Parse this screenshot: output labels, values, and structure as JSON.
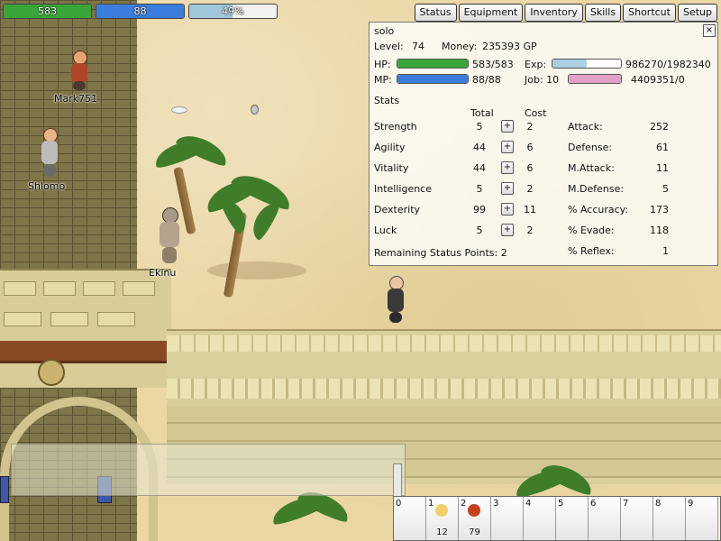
{
  "hud": {
    "hp": {
      "text": "583",
      "fraction": 1.0,
      "color": "#3aa63a"
    },
    "mp": {
      "text": "88",
      "fraction": 1.0,
      "color": "#3b7ddc"
    },
    "xp": {
      "text": "49%",
      "fraction": 0.49,
      "color": "#9fc7d9"
    }
  },
  "menu": [
    "Status",
    "Equipment",
    "Inventory",
    "Skills",
    "Shortcut",
    "Setup"
  ],
  "players": [
    {
      "name": "Mark751"
    },
    {
      "name": "Shlomo"
    },
    {
      "name": "Ekinu"
    }
  ],
  "status_window": {
    "title": "solo",
    "close": "×",
    "level_label": "Level:",
    "level": "74",
    "money_label": "Money:",
    "money": "235393 GP",
    "hp_label": "HP:",
    "hp_text": "583/583",
    "hp_fraction": 1.0,
    "mp_label": "MP:",
    "mp_text": "88/88",
    "mp_fraction": 1.0,
    "exp_label": "Exp:",
    "exp_text": "986270/1982340",
    "exp_fraction": 0.5,
    "job_label": "Job: 10",
    "job_text": "4409351/0",
    "job_fraction": 1.0,
    "stats_heading": "Stats",
    "total_header": "Total",
    "cost_header": "Cost",
    "stats": [
      {
        "name": "Strength",
        "total": "5",
        "cost": "2"
      },
      {
        "name": "Agility",
        "total": "44",
        "cost": "6"
      },
      {
        "name": "Vitality",
        "total": "44",
        "cost": "6"
      },
      {
        "name": "Intelligence",
        "total": "5",
        "cost": "2"
      },
      {
        "name": "Dexterity",
        "total": "99",
        "cost": "11"
      },
      {
        "name": "Luck",
        "total": "5",
        "cost": "2"
      }
    ],
    "plus_label": "+",
    "derived": [
      {
        "name": "Attack:",
        "value": "252"
      },
      {
        "name": "Defense:",
        "value": "61"
      },
      {
        "name": "M.Attack:",
        "value": "11"
      },
      {
        "name": "M.Defense:",
        "value": "5"
      },
      {
        "name": "% Accuracy:",
        "value": "173"
      },
      {
        "name": "% Evade:",
        "value": "118"
      },
      {
        "name": "% Reflex:",
        "value": "1"
      }
    ],
    "remaining_label": "Remaining Status Points: 2"
  },
  "shortcuts": [
    {
      "num": "0",
      "qty": ""
    },
    {
      "num": "1",
      "qty": "12"
    },
    {
      "num": "2",
      "qty": "79"
    },
    {
      "num": "3",
      "qty": ""
    },
    {
      "num": "4",
      "qty": ""
    },
    {
      "num": "5",
      "qty": ""
    },
    {
      "num": "6",
      "qty": ""
    },
    {
      "num": "7",
      "qty": ""
    },
    {
      "num": "8",
      "qty": ""
    },
    {
      "num": "9",
      "qty": ""
    }
  ]
}
